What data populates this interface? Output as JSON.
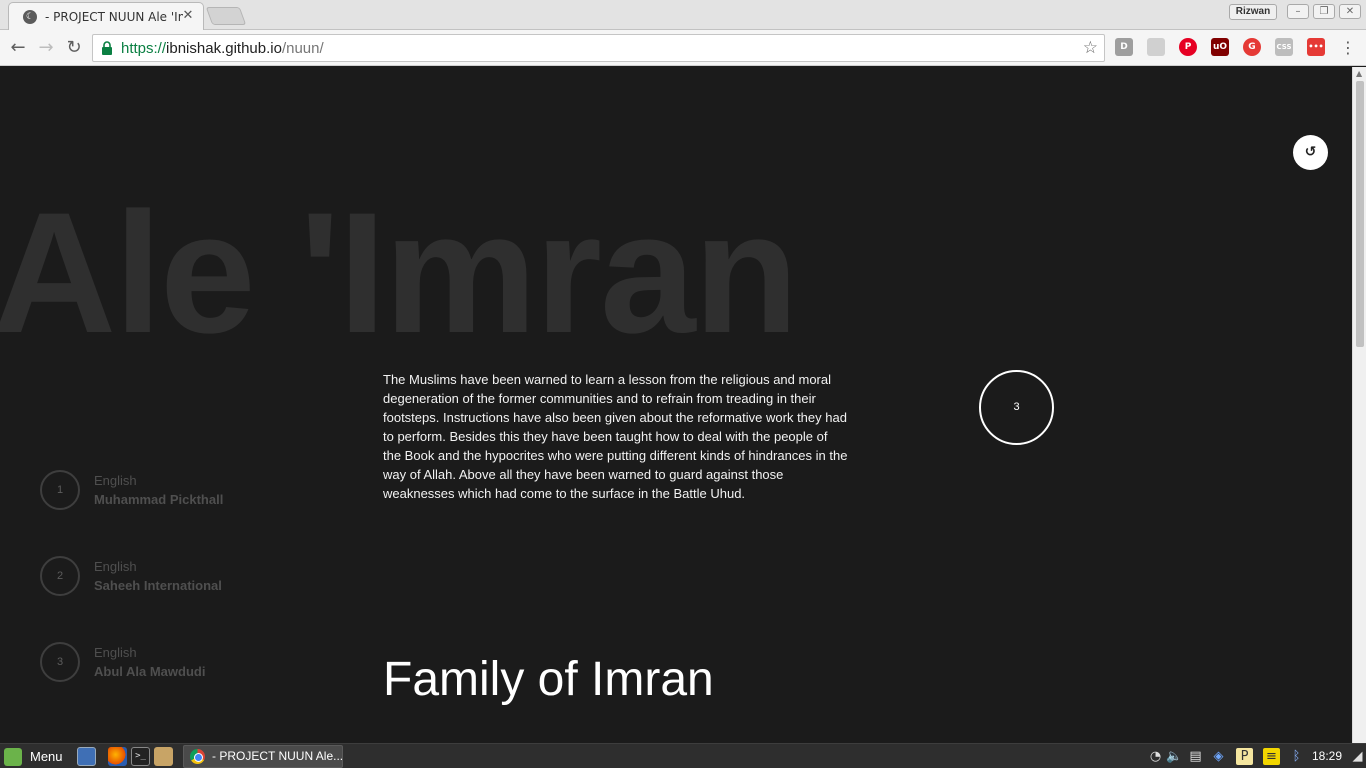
{
  "browser": {
    "tab_title": "- PROJECT NUUN Ale 'Imran",
    "tab_close": "✕",
    "profile_name": "Rizwan",
    "url_scheme": "https://",
    "url_host": "ibnishak.github.io",
    "url_path": "/nuun/",
    "extensions": [
      {
        "name": "D",
        "color": "#9e9e9e"
      },
      {
        "name": "",
        "color": "#d0d0d0"
      },
      {
        "name": "P",
        "color": "#e60023"
      },
      {
        "name": "uO",
        "color": "#800000"
      },
      {
        "name": "G",
        "color": "#e53935"
      },
      {
        "name": "CSS",
        "color": "#bdbdbd"
      },
      {
        "name": "•••",
        "color": "#e53935"
      }
    ]
  },
  "page": {
    "bg_title": "Ale 'Imran",
    "reload_symbol": "↺",
    "description": "The Muslims have been warned to learn a lesson from the religious and moral degeneration of the former communities and to refrain from treading in their footsteps. Instructions have also been given about the reformative work they had to perform. Besides this they have been taught how to deal with the people of the Book and the hypocrites who were putting different kinds of hindrances in the way of Allah. Above all they have been warned to guard against those weaknesses which had come to the surface in the Battle Uhud.",
    "surah_number": "3",
    "translations": [
      {
        "number": "1",
        "language": "English",
        "translator": "Muhammad Pickthall"
      },
      {
        "number": "2",
        "language": "English",
        "translator": "Saheeh International"
      },
      {
        "number": "3",
        "language": "English",
        "translator": "Abul Ala Mawdudi"
      }
    ],
    "surah_english_name": "Family of Imran"
  },
  "taskbar": {
    "menu_label": "Menu",
    "window_label": "- PROJECT NUUN Ale...",
    "clock": "18:29"
  }
}
